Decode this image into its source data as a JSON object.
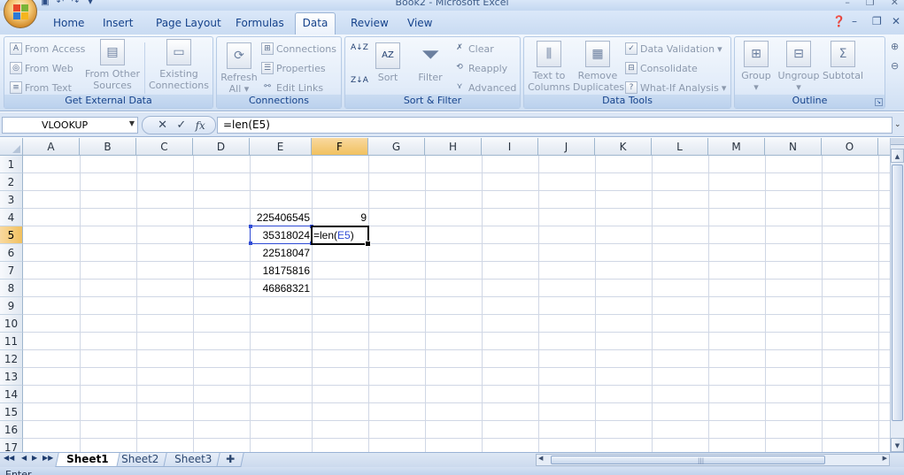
{
  "window": {
    "title": "Book2 - Microsoft Excel"
  },
  "tabs": [
    "Home",
    "Insert",
    "Page Layout",
    "Formulas",
    "Data",
    "Review",
    "View"
  ],
  "active_tab": "Data",
  "ribbon": {
    "get_external_data": {
      "label": "Get External Data",
      "from_access": "From Access",
      "from_web": "From Web",
      "from_text": "From Text",
      "from_other_sources_1": "From Other",
      "from_other_sources_2": "Sources",
      "existing_connections_1": "Existing",
      "existing_connections_2": "Connections"
    },
    "connections": {
      "label": "Connections",
      "refresh_1": "Refresh",
      "refresh_2": "All",
      "connections": "Connections",
      "properties": "Properties",
      "edit_links": "Edit Links"
    },
    "sort_filter": {
      "label": "Sort & Filter",
      "sort": "Sort",
      "filter": "Filter",
      "clear": "Clear",
      "reapply": "Reapply",
      "advanced": "Advanced"
    },
    "data_tools": {
      "label": "Data Tools",
      "text_to_columns_1": "Text to",
      "text_to_columns_2": "Columns",
      "remove_duplicates_1": "Remove",
      "remove_duplicates_2": "Duplicates",
      "data_validation": "Data Validation",
      "consolidate": "Consolidate",
      "what_if": "What-If Analysis"
    },
    "outline": {
      "label": "Outline",
      "group": "Group",
      "ungroup": "Ungroup",
      "subtotal": "Subtotal"
    }
  },
  "formula_bar": {
    "name_box": "VLOOKUP",
    "cancel": "✕",
    "enter": "✓",
    "fx": "fx",
    "formula": "=len(E5)"
  },
  "columns": [
    "A",
    "B",
    "C",
    "D",
    "E",
    "F",
    "G",
    "H",
    "I",
    "J",
    "K",
    "L",
    "M",
    "N",
    "O"
  ],
  "rows": [
    "1",
    "2",
    "3",
    "4",
    "5",
    "6",
    "7",
    "8",
    "9",
    "10",
    "11",
    "12",
    "13",
    "14",
    "15",
    "16",
    "17"
  ],
  "cells": {
    "E4": "225406545",
    "F4": "9",
    "E5": "35318024",
    "E6": "22518047",
    "E7": "18175816",
    "E8": "46868321"
  },
  "editing": {
    "prefix": "=len(",
    "ref": "E5",
    "suffix": ")"
  },
  "sheets": [
    "Sheet1",
    "Sheet2",
    "Sheet3"
  ],
  "active_sheet": "Sheet1",
  "status": {
    "mode": "Enter"
  }
}
